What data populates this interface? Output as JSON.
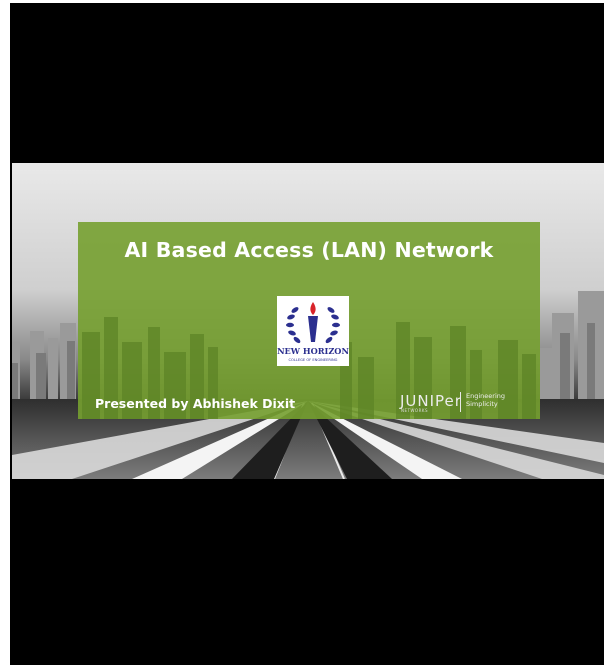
{
  "slide": {
    "title": "AI Based Access (LAN) Network",
    "presenter": "Presented by Abhishek Dixit",
    "logo": {
      "name": "NEW HORIZON",
      "subtitle": "COLLEGE OF ENGINEERING",
      "icon": "torch-laurel-emblem-icon",
      "colors": {
        "primary": "#2b2f8f",
        "flame": "#d8232a"
      }
    },
    "brand": {
      "name": "JUNIPer",
      "sub": "NETWORKS",
      "tagline_line1": "Engineering",
      "tagline_line2": "Simplicity"
    },
    "colors": {
      "panel": "#76a030",
      "letterbox": "#000000"
    }
  }
}
